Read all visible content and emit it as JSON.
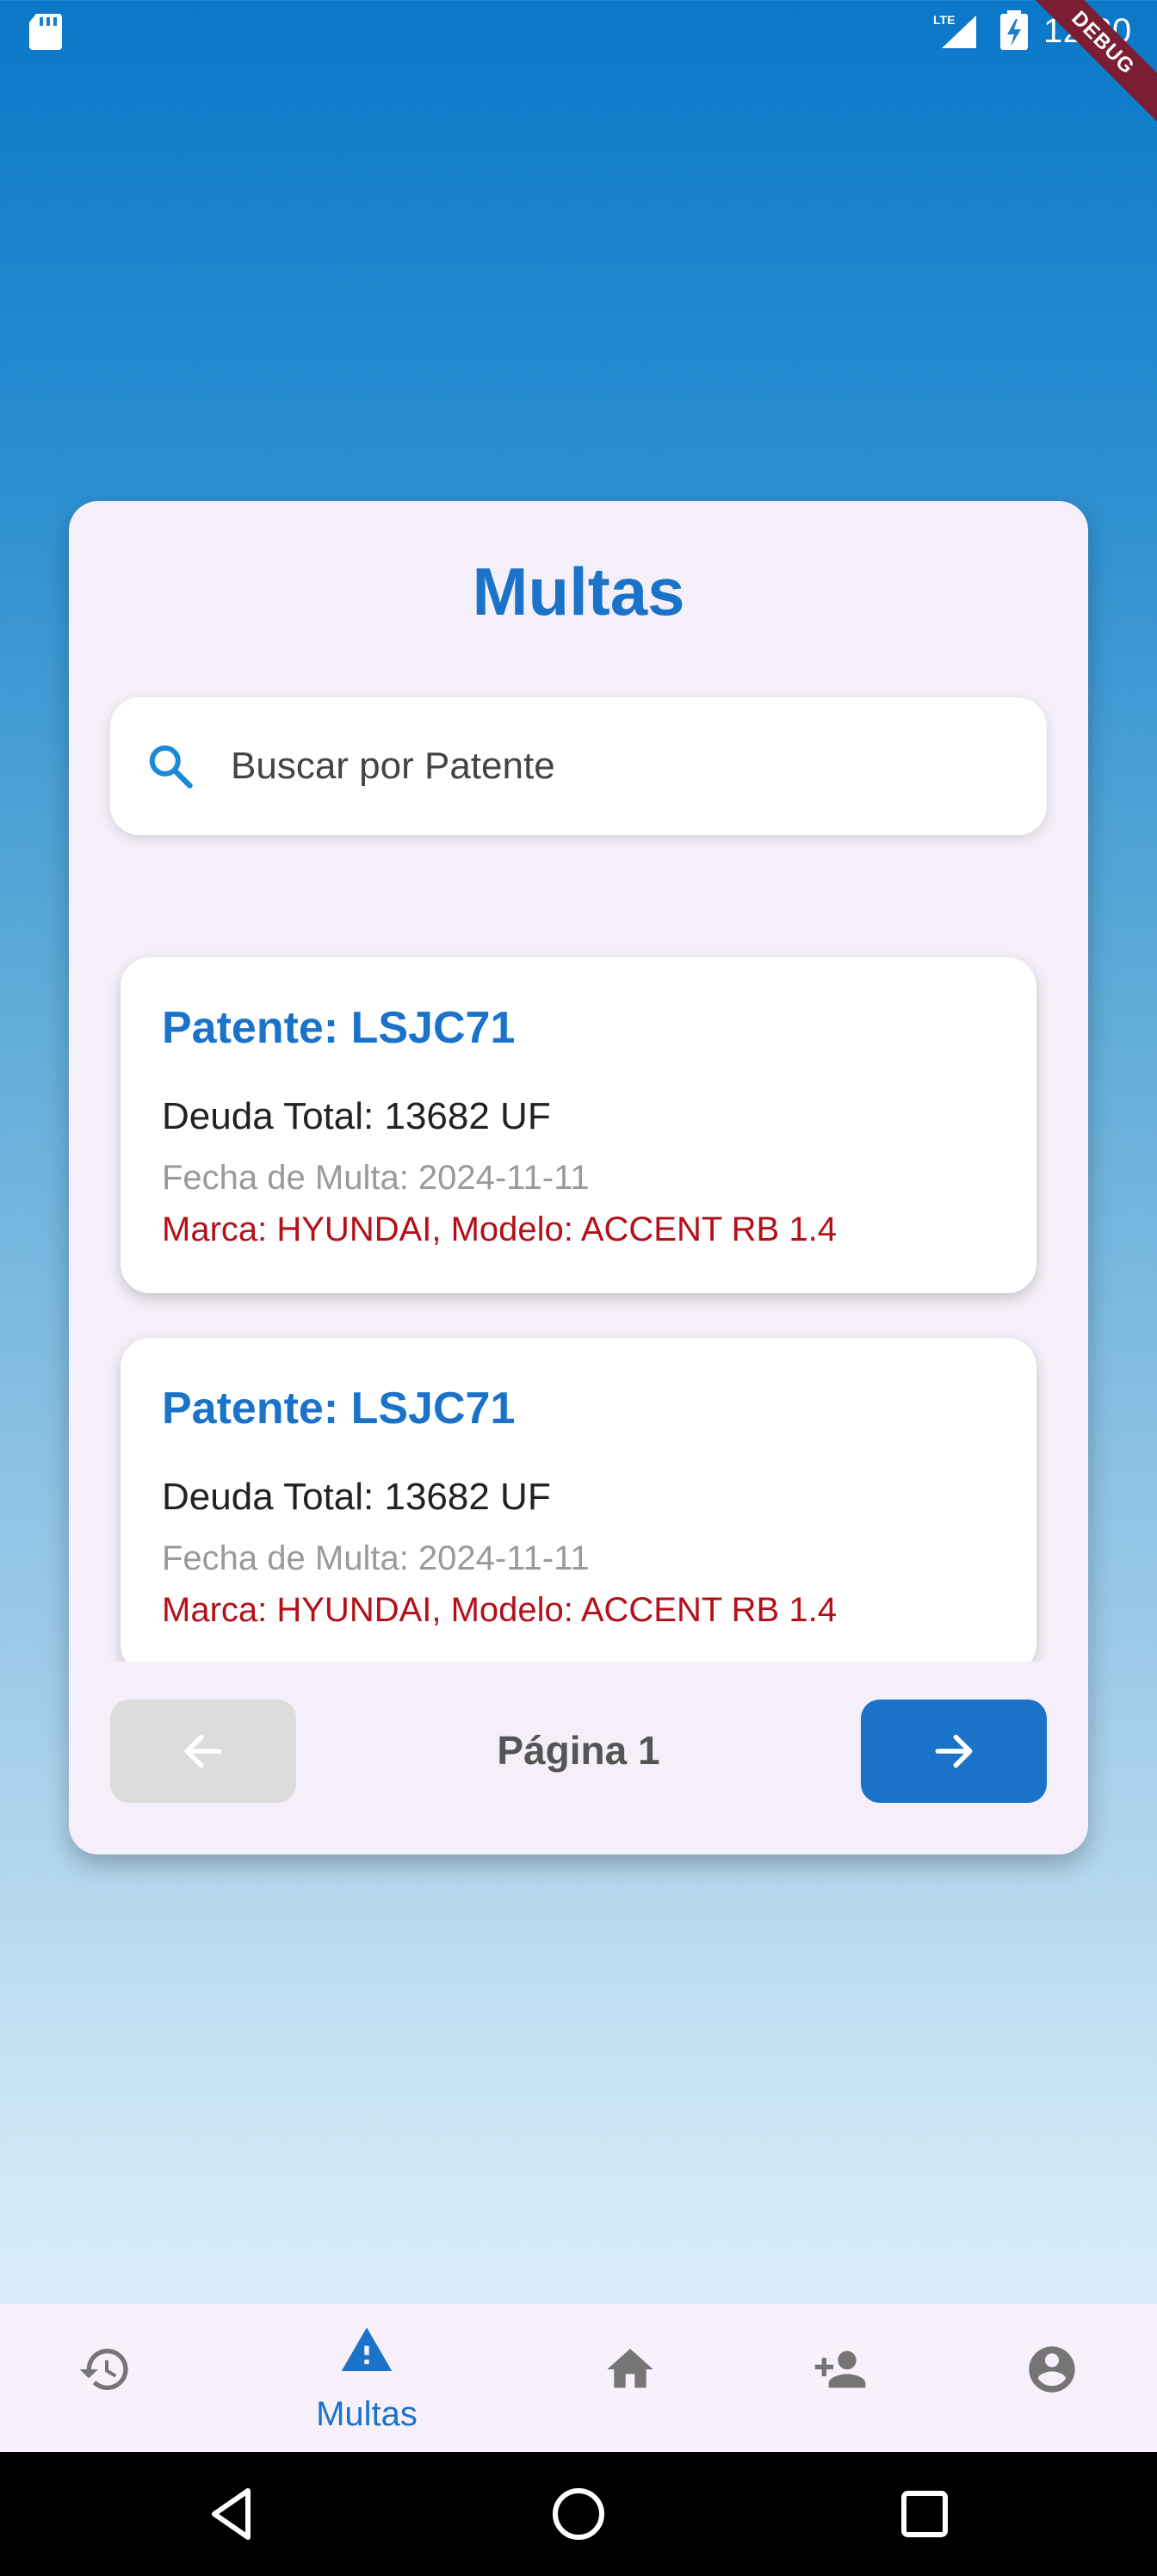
{
  "status_bar": {
    "time": "12:30",
    "network": "LTE",
    "debug_banner": "DEBUG"
  },
  "screen": {
    "title": "Multas",
    "search": {
      "placeholder": "Buscar por Patente",
      "value": ""
    },
    "fines": [
      {
        "plate": "Patente: LSJC71",
        "debt": "Deuda Total: 13682 UF",
        "date": "Fecha de Multa: 2024-11-11",
        "vehicle": "Marca: HYUNDAI, Modelo: ACCENT RB 1.4"
      },
      {
        "plate": "Patente: LSJC71",
        "debt": "Deuda Total: 13682 UF",
        "date": "Fecha de Multa: 2024-11-11",
        "vehicle": "Marca: HYUNDAI, Modelo: ACCENT RB 1.4"
      }
    ],
    "pagination": {
      "page_label": "Página 1",
      "prev_enabled": false,
      "next_enabled": true
    }
  },
  "bottom_nav": {
    "items": [
      {
        "icon": "history-icon",
        "label": ""
      },
      {
        "icon": "warning-icon",
        "label": "Multas",
        "active": true
      },
      {
        "icon": "home-icon",
        "label": ""
      },
      {
        "icon": "add-person-icon",
        "label": ""
      },
      {
        "icon": "account-circle-icon",
        "label": ""
      }
    ]
  },
  "colors": {
    "accent": "#1a73c9",
    "card_background": "#f4eff8",
    "model_text": "#b3101a",
    "date_text": "#9a9a9a",
    "disabled_button": "#dcdcdc"
  }
}
